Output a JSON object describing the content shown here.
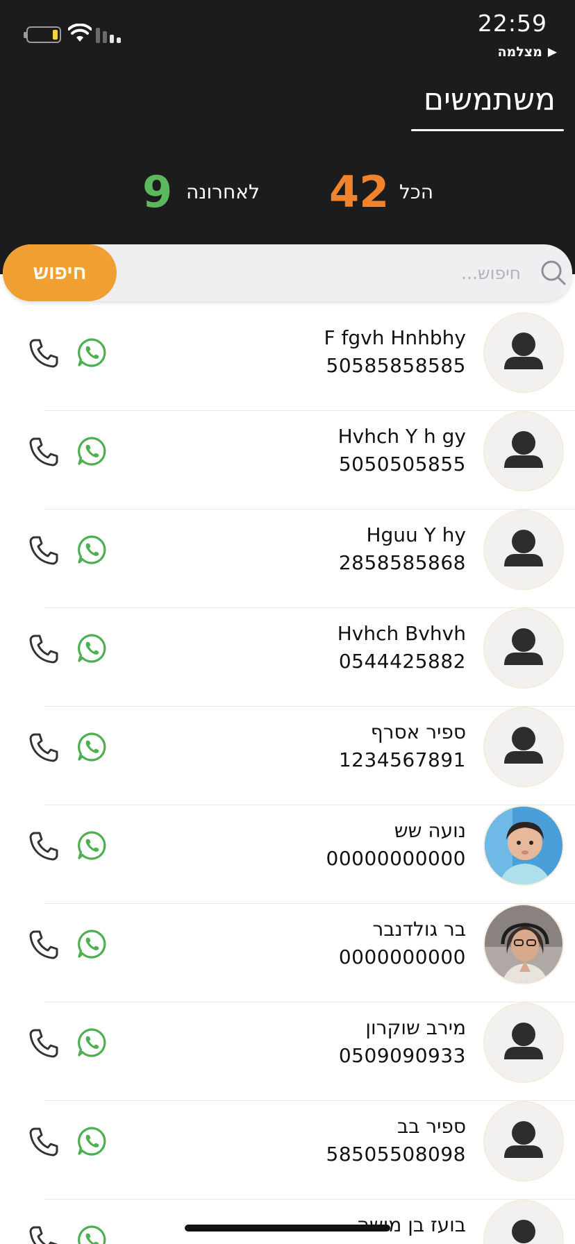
{
  "status_bar": {
    "time": "22:59",
    "back_app_label": "מצלמה",
    "back_arrow": "▶"
  },
  "header": {
    "title": "משתמשים"
  },
  "stats": {
    "all_label": "הכל",
    "all_count": "42",
    "recent_label": "לאחרונה",
    "recent_count": "9"
  },
  "colors": {
    "accent_orange": "#f0a032",
    "count_orange": "#f0832b",
    "count_green": "#5cb85c",
    "whatsapp_green": "#4caf50",
    "header_bg": "#1c1c1c"
  },
  "search": {
    "placeholder": "חיפוש...",
    "button_label": "חיפוש"
  },
  "contacts": [
    {
      "name": "F fgvh Hnhbhy",
      "phone": "50585858585",
      "avatar": "person-icon"
    },
    {
      "name": "Hvhch Y h gy",
      "phone": "5050505855",
      "avatar": "person-icon"
    },
    {
      "name": "Hguu Y hy",
      "phone": "2858585868",
      "avatar": "person-icon"
    },
    {
      "name": "Hvhch Bvhvh",
      "phone": "0544425882",
      "avatar": "person-icon"
    },
    {
      "name": "ספיר אסרף",
      "phone": "1234567891",
      "avatar": "person-icon"
    },
    {
      "name": "נועה שש",
      "phone": "00000000000",
      "avatar": "photo-baby"
    },
    {
      "name": "בר גולדנבר",
      "phone": "0000000000",
      "avatar": "photo-woman"
    },
    {
      "name": "מירב שוקרון",
      "phone": "0509090933",
      "avatar": "person-icon"
    },
    {
      "name": "ספיר בב",
      "phone": "58505508098",
      "avatar": "person-icon"
    },
    {
      "name": "בועז בן מושה",
      "phone": "",
      "avatar": "person-icon"
    }
  ]
}
